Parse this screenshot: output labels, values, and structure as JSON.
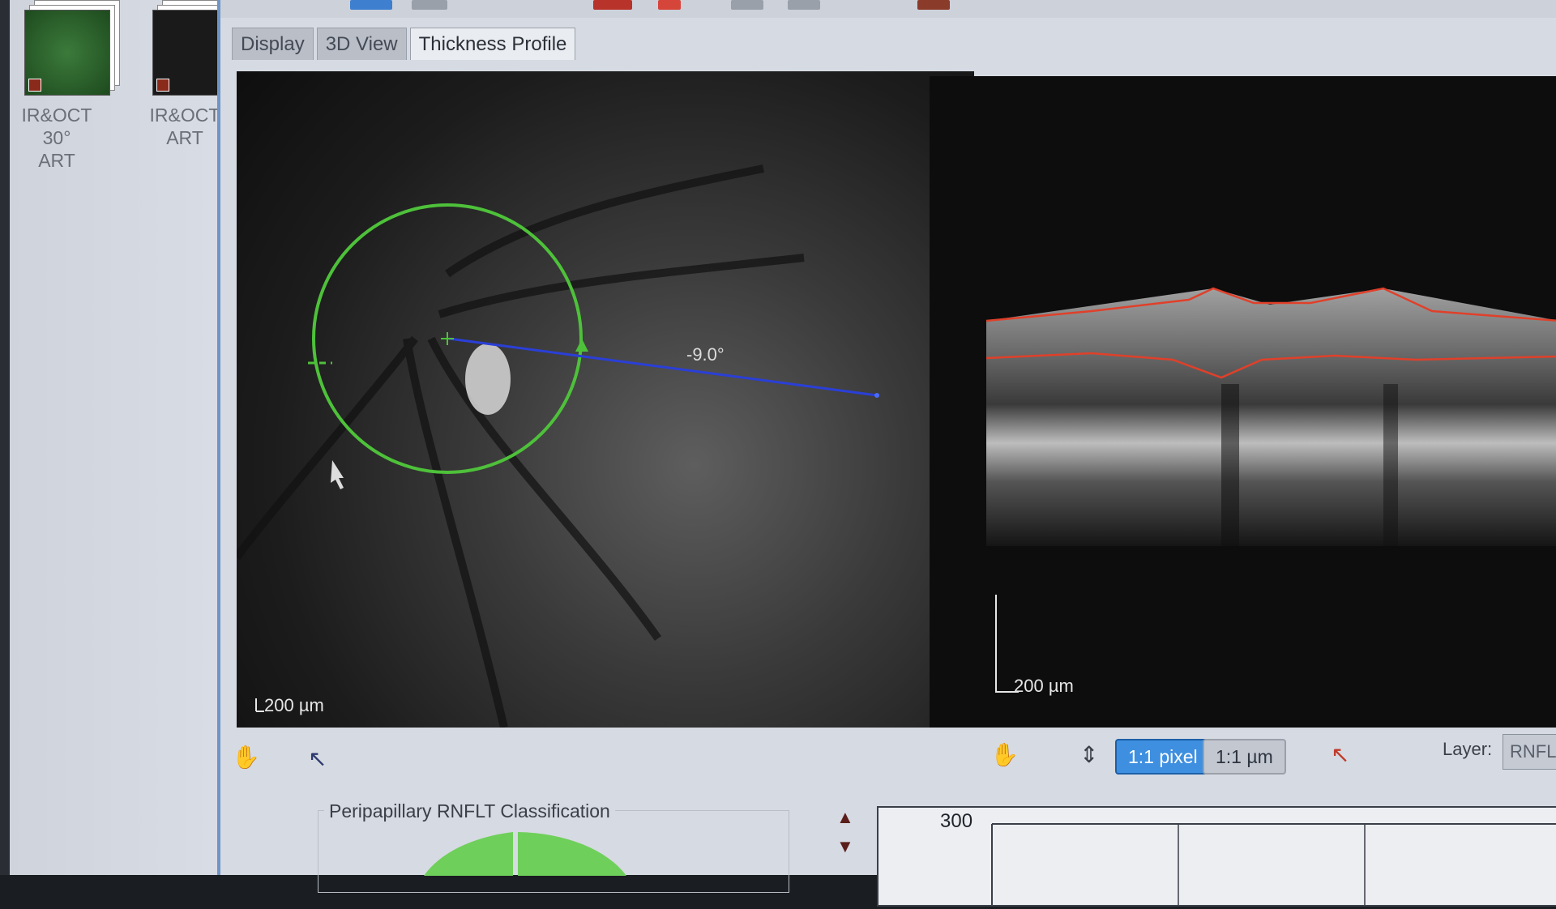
{
  "thumbnails": [
    {
      "label_line1": "IR&OCT 30°",
      "label_line2": "ART"
    },
    {
      "label_line1": "IR&OCT",
      "label_line2": "ART"
    }
  ],
  "tabs": [
    {
      "label": "Display"
    },
    {
      "label": "3D View"
    },
    {
      "label": "Thickness Profile",
      "active": true
    }
  ],
  "fundus": {
    "angle_label": "-9.0°",
    "scale_label": "200 µm"
  },
  "oct": {
    "scale_label": "200 µm"
  },
  "controls": {
    "scale_pixel": "1:1 pixel",
    "scale_um": "1:1 µm",
    "layer_label": "Layer:",
    "layer_value": "RNFL"
  },
  "classification": {
    "title": "Peripapillary RNFLT Classification"
  },
  "graph": {
    "y_tick": "300"
  },
  "colors": {
    "circle": "#4ec13a",
    "scan_line": "#2a3fd8",
    "segmentation": "#e0402a",
    "active_pill": "#3e8fe0"
  }
}
